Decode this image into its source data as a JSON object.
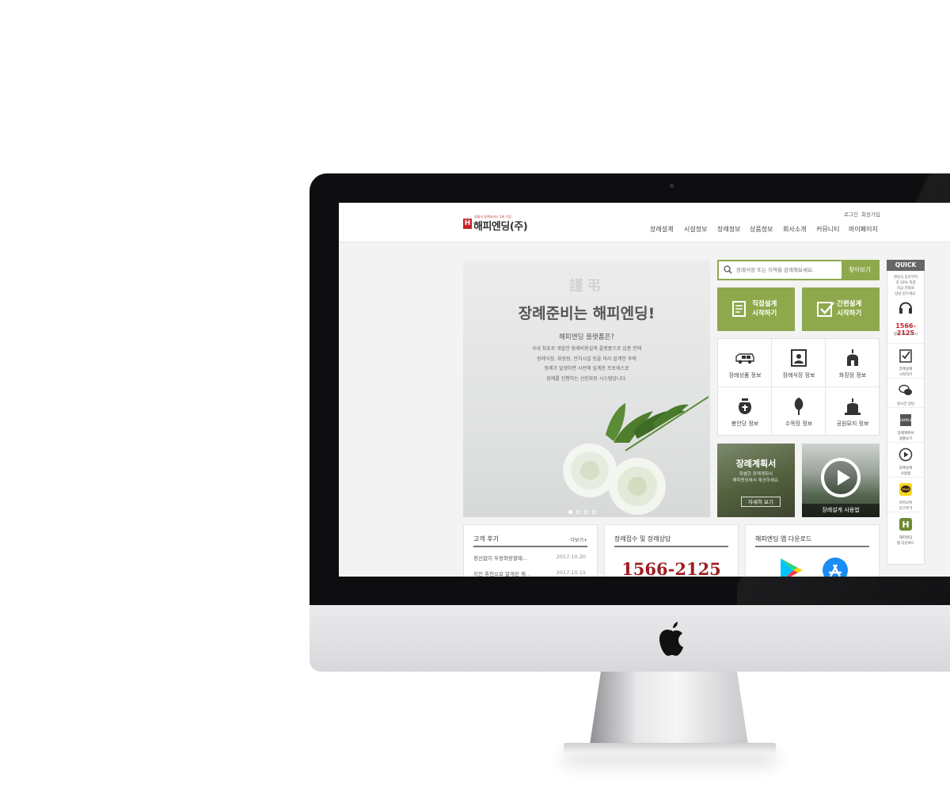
{
  "header": {
    "logo_mark": "H",
    "logo_tagline": "호불식 장례서비스 1위 기업",
    "logo_text": "해피엔딩(주)",
    "util_links": [
      "로그인",
      "회원가입"
    ],
    "nav": [
      "장례설계",
      "시설정보",
      "장례정보",
      "상품정보",
      "회사소개",
      "커뮤니티",
      "마이페이지"
    ]
  },
  "hero": {
    "seal_text": "謹弔",
    "title": "장례준비는 해피엔딩!",
    "subtitle": "해피엔딩 플랫폼은?",
    "description": [
      "국내 최초로 개발한 장례비용설계 플랫폼으로 임종 전에",
      "장례식장, 화장장, 안치시설 등을 미리 설계한 후에",
      "장례가 발생하면 사전에 설계한 프로세스로",
      "장례를 진행하는 선진화된 시스템입니다."
    ],
    "slides": 4,
    "active_slide": 1
  },
  "search": {
    "placeholder": "장례식장 또는 지역을 검색해보세요.",
    "button": "찾아보기"
  },
  "actions": [
    {
      "line1": "직접설계",
      "line2": "시작하기",
      "icon": "document-icon"
    },
    {
      "line1": "간편설계",
      "line2": "시작하기",
      "icon": "checkbox-icon"
    }
  ],
  "info_grid": [
    {
      "label": "장례상품 정보",
      "icon": "hearse-icon"
    },
    {
      "label": "장례식장 정보",
      "icon": "portrait-frame-icon"
    },
    {
      "label": "화장장 정보",
      "icon": "crematorium-icon"
    },
    {
      "label": "봉안당 정보",
      "icon": "urn-icon"
    },
    {
      "label": "수목장 정보",
      "icon": "tree-icon"
    },
    {
      "label": "공원묘지 정보",
      "icon": "tombstone-icon"
    }
  ],
  "promos": {
    "plan": {
      "title": "장례계획서",
      "sub": [
        "특별한 장례계획서",
        "해피엔딩에서 제공하세요."
      ],
      "button": "자세히 보기"
    },
    "video": {
      "label": "장례설계 사용법",
      "icon": "play-icon"
    }
  },
  "quick": {
    "title": "QUICK",
    "note": [
      "엔딩식 장호부터",
      "약 20% 저렴",
      "지금 전화로",
      "상담 받으세요."
    ],
    "phone": "1566-2125",
    "hours": "평일 9시~18시",
    "items": [
      {
        "label": [
          "장례설계",
          "시작하기"
        ],
        "icon": "checklist-icon"
      },
      {
        "label": [
          "실시간 상담"
        ],
        "icon": "chat-icon"
      },
      {
        "label": [
          "장례계획서",
          "샘플보기"
        ],
        "icon": "sample-doc-icon"
      },
      {
        "label": [
          "장례설계",
          "사용법"
        ],
        "icon": "play-icon"
      },
      {
        "label": [
          "카카오톡",
          "친구추가"
        ],
        "icon": "kakaotalk-icon"
      },
      {
        "label": [
          "해피엔딩",
          "앱 다운로드"
        ],
        "icon": "app-icon"
      }
    ]
  },
  "reviews": {
    "title": "고객 후기",
    "more": "더보기+",
    "items": [
      {
        "text": "정신없이 우왕좌왕할때...",
        "date": "2017.10.20"
      },
      {
        "text": "지인 추천으로 알게된 해...",
        "date": "2017.10.15"
      }
    ]
  },
  "consult": {
    "title": "장례접수 및 장례상담",
    "phone": "1566-2125"
  },
  "app": {
    "title": "해피엔딩 앱 다운로드",
    "stores": [
      "google-play-icon",
      "app-store-icon"
    ]
  },
  "colors": {
    "accent_green": "#8ea94c",
    "brand_red": "#c4252a",
    "phone_red": "#a01d22"
  }
}
